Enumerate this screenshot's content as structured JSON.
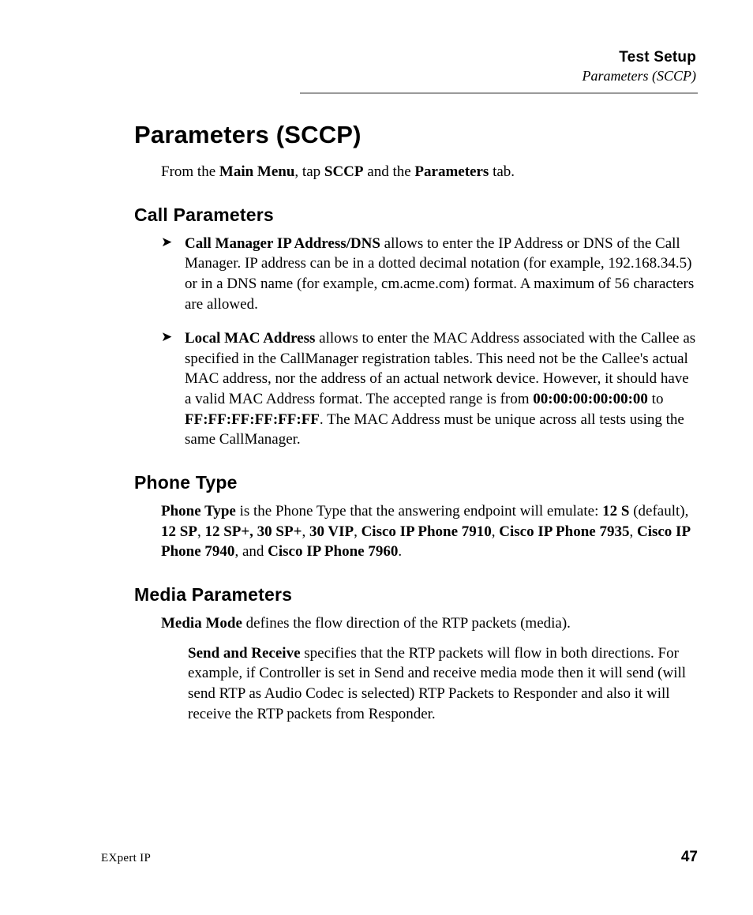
{
  "runningHead": {
    "top": "Test Setup",
    "sub": "Parameters (SCCP)"
  },
  "h1": "Parameters (SCCP)",
  "intro": {
    "t1": "From the ",
    "b1": "Main Menu",
    "t2": ", tap ",
    "b2": "SCCP",
    "t3": " and the ",
    "b3": "Parameters",
    "t4": " tab."
  },
  "sections": {
    "callParams": {
      "heading": "Call Parameters",
      "items": [
        {
          "b0": "Call Manager IP Address/DNS",
          "t": " allows to enter the IP Address or DNS of the Call Manager. IP address can be in a dotted decimal notation (for example, 192.168.34.5) or in a DNS name (for example, cm.acme.com) format. A maximum of 56 characters are allowed."
        },
        {
          "b0": "Local MAC Address",
          "t1": " allows to enter the MAC Address associated with the Callee as specified in the CallManager registration tables. This need not be the Callee's actual MAC address, nor the address of an actual network device. However, it should have a valid MAC Address format. The accepted range is from ",
          "b1": "00:00:00:00:00:00",
          "t2": " to ",
          "b2": "FF:FF:FF:FF:FF:FF",
          "t3": ". The MAC Address must be unique across all tests using the same CallManager."
        }
      ]
    },
    "phoneType": {
      "heading": "Phone Type",
      "b0": "Phone Type",
      "t1": " is the Phone Type that the answering endpoint will emulate: ",
      "b1": "12 S",
      "t2": " (default), ",
      "b2": "12 SP",
      "t2a": ", ",
      "b3": "12 SP+, 30 SP+",
      "t3": ", ",
      "b4": "30 VIP",
      "t4": ", ",
      "b5": "Cisco IP Phone 7910",
      "t5": ", ",
      "b6": "Cisco IP Phone 7935",
      "t6": ", ",
      "b7": "Cisco IP Phone 7940",
      "t7": ", and ",
      "b8": "Cisco IP Phone 7960",
      "t8": "."
    },
    "mediaParams": {
      "heading": "Media Parameters",
      "p1": {
        "b": "Media Mode",
        "t": " defines the flow direction of the RTP packets (media)."
      },
      "p2": {
        "b": "Send and Receive",
        "t": " specifies that the RTP packets will flow in both directions. For example, if Controller is set in Send and receive media mode then it will send (will send RTP as Audio Codec is selected) RTP Packets to Responder and also it will receive the RTP packets from Responder."
      }
    }
  },
  "footer": {
    "product": "EXpert IP",
    "page": "47"
  }
}
